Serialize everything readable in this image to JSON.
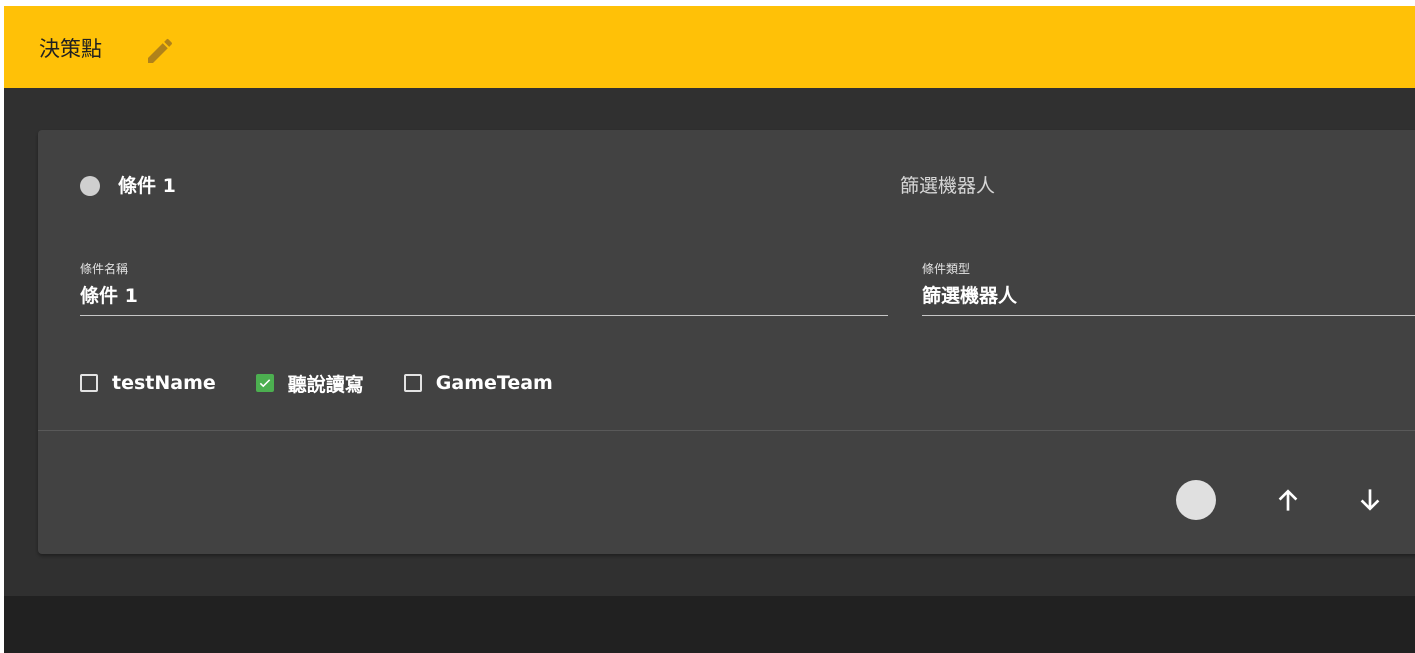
{
  "header": {
    "title": "決策點",
    "edit_icon": "pencil-icon",
    "background_color": "#FFC107"
  },
  "condition": {
    "status_icon": "circle-icon",
    "title": "條件 1",
    "type_title": "篩選機器人",
    "name_field": {
      "label": "條件名稱",
      "value": "條件 1"
    },
    "type_field": {
      "label": "條件類型",
      "value": "篩選機器人"
    },
    "checkboxes": [
      {
        "label": "testName",
        "checked": false
      },
      {
        "label": "聽說讀寫",
        "checked": true
      },
      {
        "label": "GameTeam",
        "checked": false
      }
    ],
    "actions": {
      "status_icon": "circle-icon",
      "up_icon": "arrow-up-icon",
      "down_icon": "arrow-down-icon"
    }
  },
  "colors": {
    "accent": "#FFC107",
    "checked": "#4CAF50",
    "card_bg": "#424242",
    "page_bg": "#303030"
  }
}
